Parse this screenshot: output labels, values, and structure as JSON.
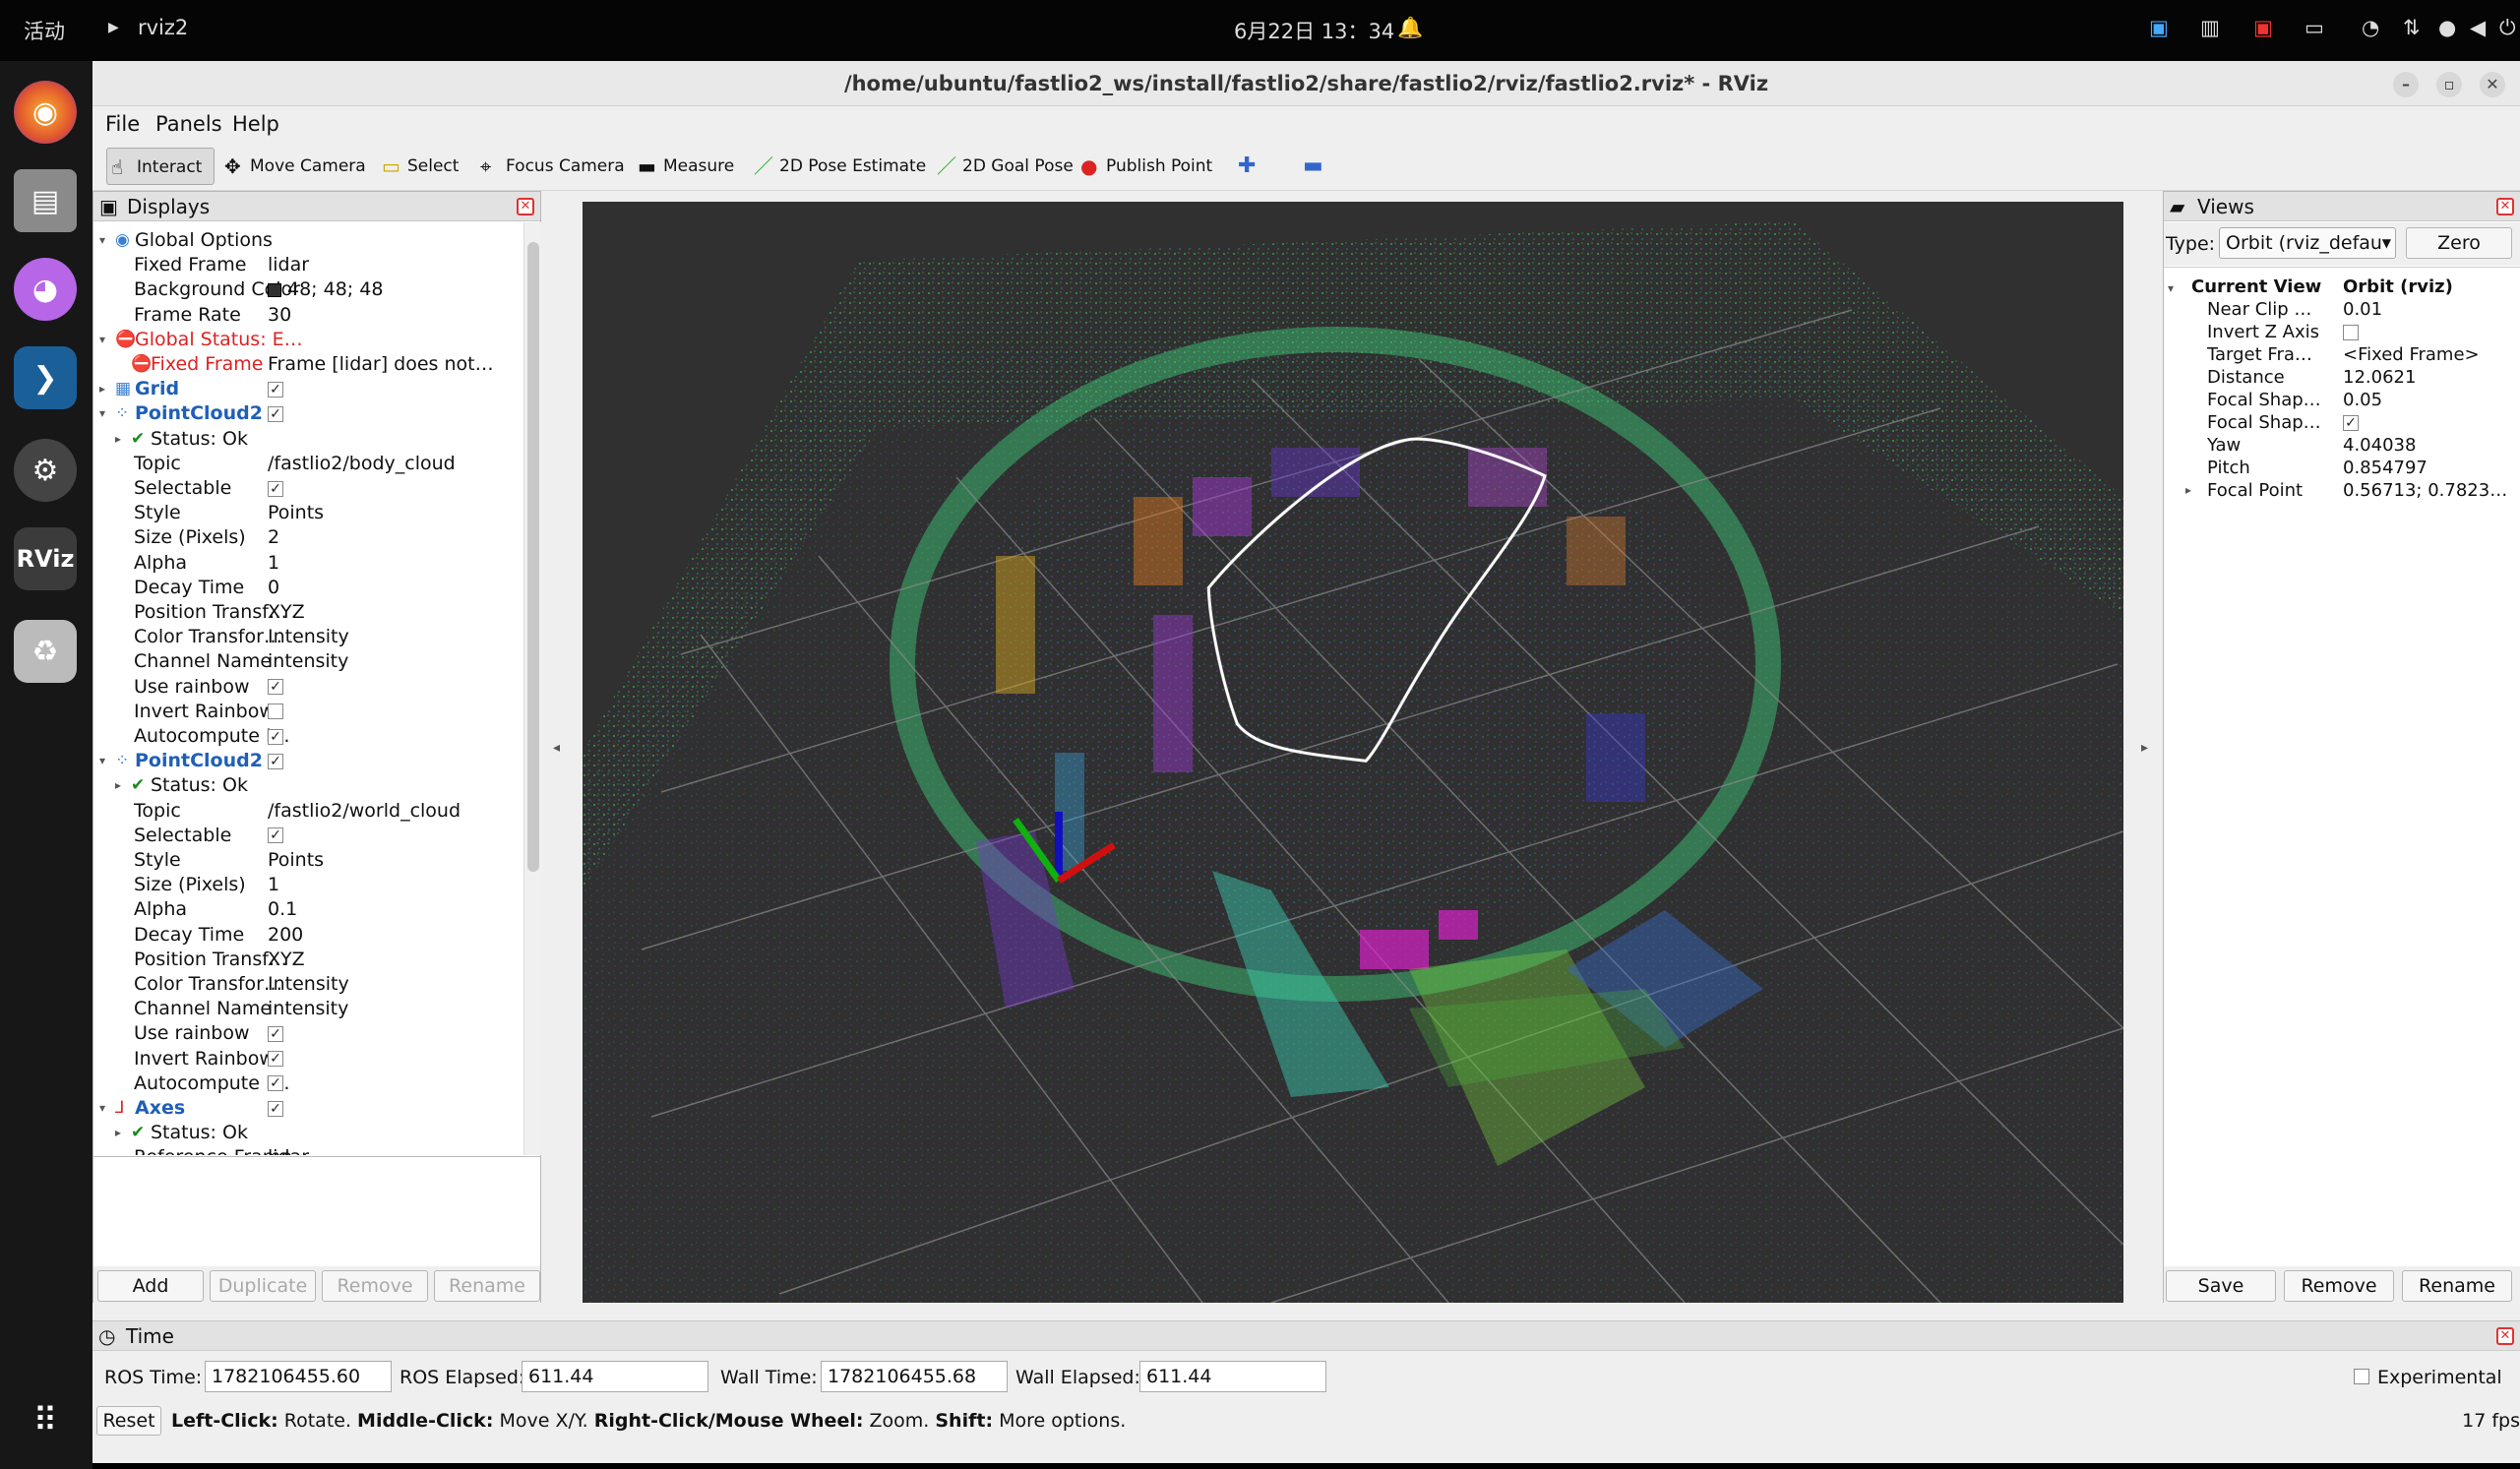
{
  "topbar": {
    "activities": "活动",
    "app_name": "rviz2",
    "clock": "6月22日 13：34"
  },
  "window": {
    "title": "/home/ubuntu/fastlio2_ws/install/fastlio2/share/fastlio2/rviz/fastlio2.rviz* - RViz"
  },
  "menu": {
    "file": "File",
    "panels": "Panels",
    "help": "Help"
  },
  "toolbar": {
    "interact": "Interact",
    "move_camera": "Move Camera",
    "select": "Select",
    "focus_camera": "Focus Camera",
    "measure": "Measure",
    "pose_estimate": "2D Pose Estimate",
    "goal_pose": "2D Goal Pose",
    "publish_point": "Publish Point"
  },
  "displays": {
    "title": "Displays",
    "rows": [
      {
        "indent": 0,
        "arrow": "▾",
        "icon": "globe",
        "name": "Global Options",
        "value": "",
        "style": "normal"
      },
      {
        "indent": 1,
        "arrow": "",
        "icon": "",
        "name": "Fixed Frame",
        "value": "lidar",
        "style": "normal"
      },
      {
        "indent": 1,
        "arrow": "",
        "icon": "",
        "name": "Background Color",
        "value": "48; 48; 48",
        "style": "normal",
        "swatch": "#303030"
      },
      {
        "indent": 1,
        "arrow": "",
        "icon": "",
        "name": "Frame Rate",
        "value": "30",
        "style": "normal"
      },
      {
        "indent": 0,
        "arrow": "▾",
        "icon": "error",
        "name": "Global Status: E…",
        "value": "",
        "style": "error"
      },
      {
        "indent": 1,
        "arrow": "",
        "icon": "error",
        "name": "Fixed Frame",
        "value": "Frame [lidar] does not…",
        "style": "error"
      },
      {
        "indent": 0,
        "arrow": "▸",
        "icon": "grid",
        "name": "Grid",
        "value": "",
        "check": true,
        "style": "blue"
      },
      {
        "indent": 0,
        "arrow": "▾",
        "icon": "cloud",
        "name": "PointCloud2",
        "value": "",
        "check": true,
        "style": "blue"
      },
      {
        "indent": 1,
        "arrow": "▸",
        "icon": "ok",
        "name": "Status: Ok",
        "value": "",
        "style": "normal"
      },
      {
        "indent": 1,
        "arrow": "",
        "icon": "",
        "name": "Topic",
        "value": "/fastlio2/body_cloud",
        "style": "normal"
      },
      {
        "indent": 1,
        "arrow": "",
        "icon": "",
        "name": "Selectable",
        "value": "",
        "check": true,
        "style": "normal"
      },
      {
        "indent": 1,
        "arrow": "",
        "icon": "",
        "name": "Style",
        "value": "Points",
        "style": "normal"
      },
      {
        "indent": 1,
        "arrow": "",
        "icon": "",
        "name": "Size (Pixels)",
        "value": "2",
        "style": "normal"
      },
      {
        "indent": 1,
        "arrow": "",
        "icon": "",
        "name": "Alpha",
        "value": "1",
        "style": "normal"
      },
      {
        "indent": 1,
        "arrow": "",
        "icon": "",
        "name": "Decay Time",
        "value": "0",
        "style": "normal"
      },
      {
        "indent": 1,
        "arrow": "",
        "icon": "",
        "name": "Position Transf…",
        "value": "XYZ",
        "style": "normal"
      },
      {
        "indent": 1,
        "arrow": "",
        "icon": "",
        "name": "Color Transfor…",
        "value": "Intensity",
        "style": "normal"
      },
      {
        "indent": 1,
        "arrow": "",
        "icon": "",
        "name": "Channel Name",
        "value": "intensity",
        "style": "normal"
      },
      {
        "indent": 1,
        "arrow": "",
        "icon": "",
        "name": "Use rainbow",
        "value": "",
        "check": true,
        "style": "normal"
      },
      {
        "indent": 1,
        "arrow": "",
        "icon": "",
        "name": "Invert Rainbow",
        "value": "",
        "check": false,
        "style": "normal"
      },
      {
        "indent": 1,
        "arrow": "",
        "icon": "",
        "name": "Autocompute I…",
        "value": "",
        "check": true,
        "style": "normal"
      },
      {
        "indent": 0,
        "arrow": "▾",
        "icon": "cloud",
        "name": "PointCloud2",
        "value": "",
        "check": true,
        "style": "blue"
      },
      {
        "indent": 1,
        "arrow": "▸",
        "icon": "ok",
        "name": "Status: Ok",
        "value": "",
        "style": "normal"
      },
      {
        "indent": 1,
        "arrow": "",
        "icon": "",
        "name": "Topic",
        "value": "/fastlio2/world_cloud",
        "style": "normal"
      },
      {
        "indent": 1,
        "arrow": "",
        "icon": "",
        "name": "Selectable",
        "value": "",
        "check": true,
        "style": "normal"
      },
      {
        "indent": 1,
        "arrow": "",
        "icon": "",
        "name": "Style",
        "value": "Points",
        "style": "normal"
      },
      {
        "indent": 1,
        "arrow": "",
        "icon": "",
        "name": "Size (Pixels)",
        "value": "1",
        "style": "normal"
      },
      {
        "indent": 1,
        "arrow": "",
        "icon": "",
        "name": "Alpha",
        "value": "0.1",
        "style": "normal"
      },
      {
        "indent": 1,
        "arrow": "",
        "icon": "",
        "name": "Decay Time",
        "value": "200",
        "style": "normal"
      },
      {
        "indent": 1,
        "arrow": "",
        "icon": "",
        "name": "Position Transf…",
        "value": "XYZ",
        "style": "normal"
      },
      {
        "indent": 1,
        "arrow": "",
        "icon": "",
        "name": "Color Transfor…",
        "value": "Intensity",
        "style": "normal"
      },
      {
        "indent": 1,
        "arrow": "",
        "icon": "",
        "name": "Channel Name",
        "value": "intensity",
        "style": "normal"
      },
      {
        "indent": 1,
        "arrow": "",
        "icon": "",
        "name": "Use rainbow",
        "value": "",
        "check": true,
        "style": "normal"
      },
      {
        "indent": 1,
        "arrow": "",
        "icon": "",
        "name": "Invert Rainbow",
        "value": "",
        "check": true,
        "style": "normal"
      },
      {
        "indent": 1,
        "arrow": "",
        "icon": "",
        "name": "Autocompute I…",
        "value": "",
        "check": true,
        "style": "normal"
      },
      {
        "indent": 0,
        "arrow": "▾",
        "icon": "axes",
        "name": "Axes",
        "value": "",
        "check": true,
        "style": "blue"
      },
      {
        "indent": 1,
        "arrow": "▸",
        "icon": "ok",
        "name": "Status: Ok",
        "value": "",
        "style": "normal"
      },
      {
        "indent": 1,
        "arrow": "",
        "icon": "",
        "name": "Reference Frame",
        "value": "lidar",
        "style": "normal"
      }
    ],
    "buttons": {
      "add": "Add",
      "duplicate": "Duplicate",
      "remove": "Remove",
      "rename": "Rename"
    }
  },
  "views": {
    "title": "Views",
    "type_label": "Type:",
    "type_value": "Orbit (rviz_defau",
    "zero": "Zero",
    "current_view": "Current View",
    "current_view_type": "Orbit (rviz)",
    "props": [
      {
        "name": "Near Clip …",
        "value": "0.01"
      },
      {
        "name": "Invert Z Axis",
        "value": "",
        "check": false
      },
      {
        "name": "Target Fra…",
        "value": "<Fixed Frame>"
      },
      {
        "name": "Distance",
        "value": "12.0621"
      },
      {
        "name": "Focal Shap…",
        "value": "0.05"
      },
      {
        "name": "Focal Shap…",
        "value": "",
        "check": true
      },
      {
        "name": "Yaw",
        "value": "4.04038"
      },
      {
        "name": "Pitch",
        "value": "0.854797"
      },
      {
        "name": "Focal Point",
        "value": "0.56713; 0.7823…",
        "arrow": true
      }
    ],
    "buttons": {
      "save": "Save",
      "remove": "Remove",
      "rename": "Rename"
    }
  },
  "time": {
    "title": "Time",
    "ros_time_label": "ROS Time:",
    "ros_time": "1782106455.60",
    "ros_elapsed_label": "ROS Elapsed:",
    "ros_elapsed": "611.44",
    "wall_time_label": "Wall Time:",
    "wall_time": "1782106455.68",
    "wall_elapsed_label": "Wall Elapsed:",
    "wall_elapsed": "611.44",
    "experimental": "Experimental"
  },
  "status": {
    "reset": "Reset",
    "left_click": "Left-Click:",
    "left_click_text": "Rotate.",
    "middle_click": "Middle-Click:",
    "middle_click_text": "Move X/Y.",
    "right_click": "Right-Click/Mouse Wheel:",
    "right_click_text": "Zoom.",
    "shift": "Shift:",
    "shift_text": "More options.",
    "fps": "17 fps"
  }
}
